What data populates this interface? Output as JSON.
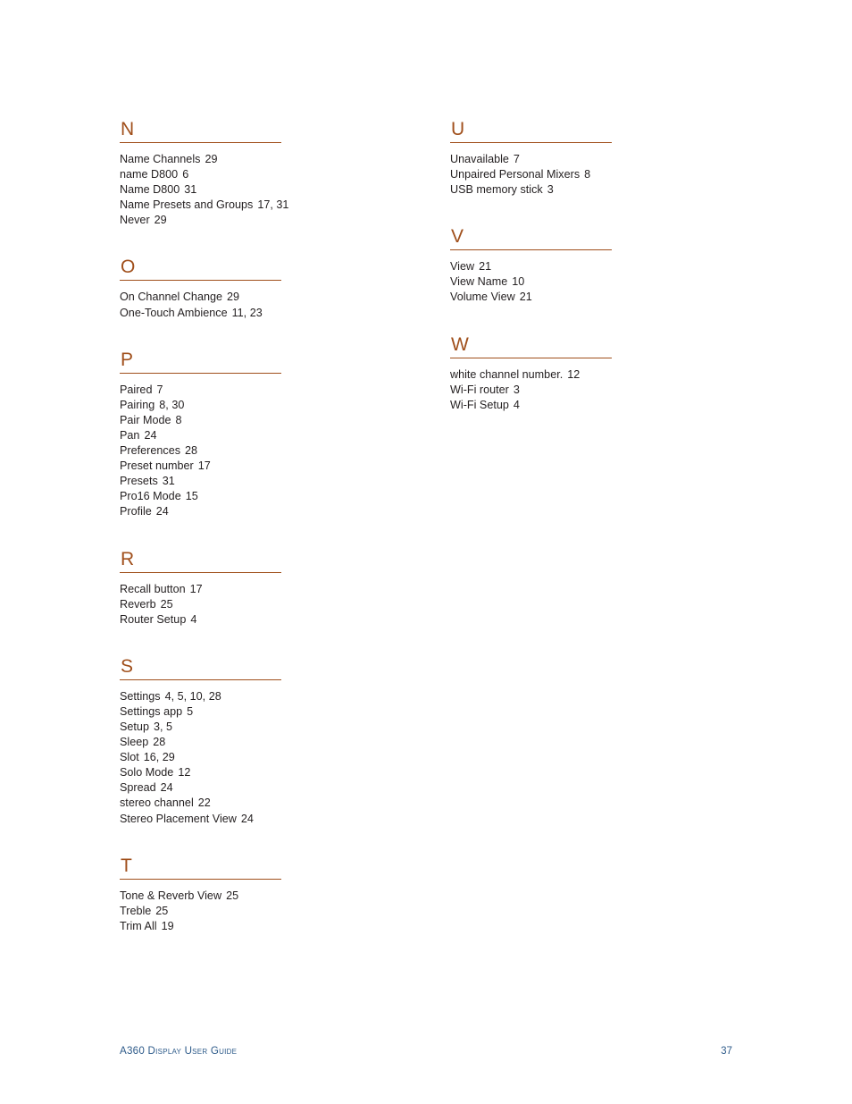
{
  "page": {
    "background_color": "#ffffff",
    "heading_color": "#A04F1B",
    "body_text_color": "#231F20",
    "footer_color": "#2E5B8A"
  },
  "columns": {
    "left": [
      {
        "letter": "N",
        "entries": [
          {
            "term": "Name Channels",
            "pages": "29"
          },
          {
            "term": "name D800",
            "pages": "6"
          },
          {
            "term": "Name D800",
            "pages": "31"
          },
          {
            "term": "Name Presets and Groups",
            "pages": "17, 31"
          },
          {
            "term": "Never",
            "pages": "29"
          }
        ]
      },
      {
        "letter": "O",
        "entries": [
          {
            "term": "On Channel Change",
            "pages": "29"
          },
          {
            "term": "One-Touch Ambience",
            "pages": "11, 23"
          }
        ]
      },
      {
        "letter": "P",
        "entries": [
          {
            "term": "Paired",
            "pages": "7"
          },
          {
            "term": "Pairing",
            "pages": "8, 30"
          },
          {
            "term": "Pair Mode",
            "pages": "8"
          },
          {
            "term": "Pan",
            "pages": "24"
          },
          {
            "term": "Preferences",
            "pages": "28"
          },
          {
            "term": "Preset number",
            "pages": "17"
          },
          {
            "term": "Presets",
            "pages": "31"
          },
          {
            "term": "Pro16 Mode",
            "pages": "15"
          },
          {
            "term": "Profile",
            "pages": "24"
          }
        ]
      },
      {
        "letter": "R",
        "entries": [
          {
            "term": "Recall button",
            "pages": "17"
          },
          {
            "term": "Reverb",
            "pages": "25"
          },
          {
            "term": "Router Setup",
            "pages": "4"
          }
        ]
      },
      {
        "letter": "S",
        "entries": [
          {
            "term": "Settings",
            "pages": "4, 5, 10, 28"
          },
          {
            "term": "Settings app",
            "pages": "5"
          },
          {
            "term": "Setup",
            "pages": "3, 5"
          },
          {
            "term": "Sleep",
            "pages": "28"
          },
          {
            "term": "Slot",
            "pages": "16, 29"
          },
          {
            "term": "Solo Mode",
            "pages": "12"
          },
          {
            "term": "Spread",
            "pages": "24"
          },
          {
            "term": "stereo channel",
            "pages": "22"
          },
          {
            "term": "Stereo Placement View",
            "pages": "24"
          }
        ]
      },
      {
        "letter": "T",
        "entries": [
          {
            "term": "Tone & Reverb View",
            "pages": "25"
          },
          {
            "term": "Treble",
            "pages": "25"
          },
          {
            "term": "Trim All",
            "pages": "19"
          }
        ]
      }
    ],
    "right": [
      {
        "letter": "U",
        "entries": [
          {
            "term": "Unavailable",
            "pages": "7"
          },
          {
            "term": "Unpaired Personal Mixers",
            "pages": "8"
          },
          {
            "term": "USB memory stick",
            "pages": "3"
          }
        ]
      },
      {
        "letter": "V",
        "entries": [
          {
            "term": "View",
            "pages": "21"
          },
          {
            "term": "View Name",
            "pages": "10"
          },
          {
            "term": "Volume View",
            "pages": "21"
          }
        ]
      },
      {
        "letter": "W",
        "entries": [
          {
            "term": "white channel number.",
            "pages": "12"
          },
          {
            "term": "Wi-Fi router",
            "pages": "3"
          },
          {
            "term": "Wi-Fi Setup",
            "pages": "4"
          }
        ]
      }
    ]
  },
  "footer": {
    "title": "A360 Display User Guide",
    "page_number": "37"
  }
}
